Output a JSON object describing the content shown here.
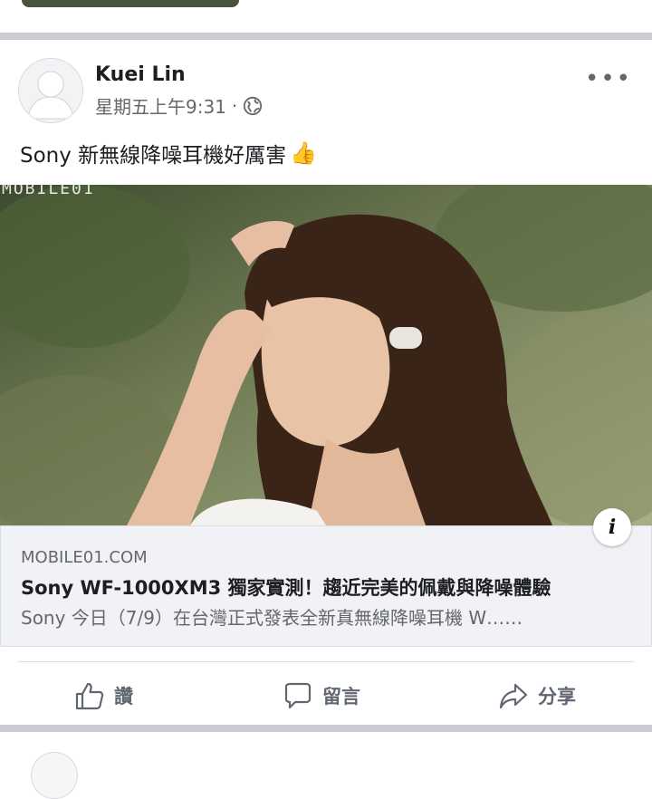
{
  "post": {
    "author": "Kuei Lin",
    "timestamp": "星期五上午9:31",
    "separator": "·",
    "privacy_icon": "globe-icon",
    "more_label": "•••",
    "message": "Sony 新無線降噪耳機好厲害",
    "message_emoji": "👍"
  },
  "photo": {
    "watermark": "MOBILE01"
  },
  "link": {
    "domain": "MOBILE01.COM",
    "title": "Sony WF-1000XM3 獨家實測！趨近完美的佩戴與降噪體驗",
    "description": "Sony 今日（7/9）在台灣正式發表全新真無線降噪耳機 W……",
    "info_label": "i"
  },
  "actions": {
    "like_label": "讚",
    "comment_label": "留言",
    "share_label": "分享"
  },
  "colors": {
    "separator_bar": "#c9ccd1",
    "link_bg": "#f0f2f5",
    "secondary_text": "#65676b",
    "action_text": "#606770"
  }
}
